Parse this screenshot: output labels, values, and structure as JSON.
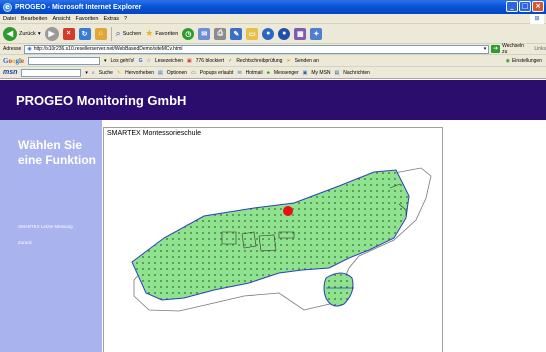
{
  "window": {
    "title": "PROGEO - Microsoft Internet Explorer"
  },
  "menu": {
    "items": [
      "Datei",
      "Bearbeiten",
      "Ansicht",
      "Favoriten",
      "Extras",
      "?"
    ]
  },
  "toolbar": {
    "back": "Zurück",
    "search": "Suchen",
    "favorites": "Favoriten"
  },
  "address": {
    "label": "Adresse",
    "url": "http://s10r236.s10.resellerserver.net/WebBasedDemo/siteMCv.html",
    "go": "Wechseln zu",
    "links": "Links"
  },
  "google": {
    "logo": "Google",
    "items": [
      "Los geht's!",
      "Lesezeichen",
      "776 blockiert",
      "Rechtschreibprüfung",
      "Senden an"
    ],
    "settings": "Einstellungen"
  },
  "msn": {
    "logo": "msn",
    "items": [
      "Suche",
      "Hervorheben",
      "Optionen",
      "Popups erlaubt",
      "Hotmail",
      "Messenger",
      "My MSN",
      "Nachrichten"
    ]
  },
  "page": {
    "header": "PROGEO Monitoring GmbH",
    "sidebar": {
      "heading": "Wählen Sie eine Funktion",
      "links": [
        "SMARTEX Letzte Messung",
        "Zurück"
      ]
    },
    "content_title": "SMARTEX Montessorieschule"
  },
  "colors": {
    "header_bg": "#2b0d6d",
    "sidebar_bg": "#a9b3ee",
    "map_fill": "#8fe38f",
    "map_stroke": "#2a40c0",
    "marker": "#e81010"
  }
}
